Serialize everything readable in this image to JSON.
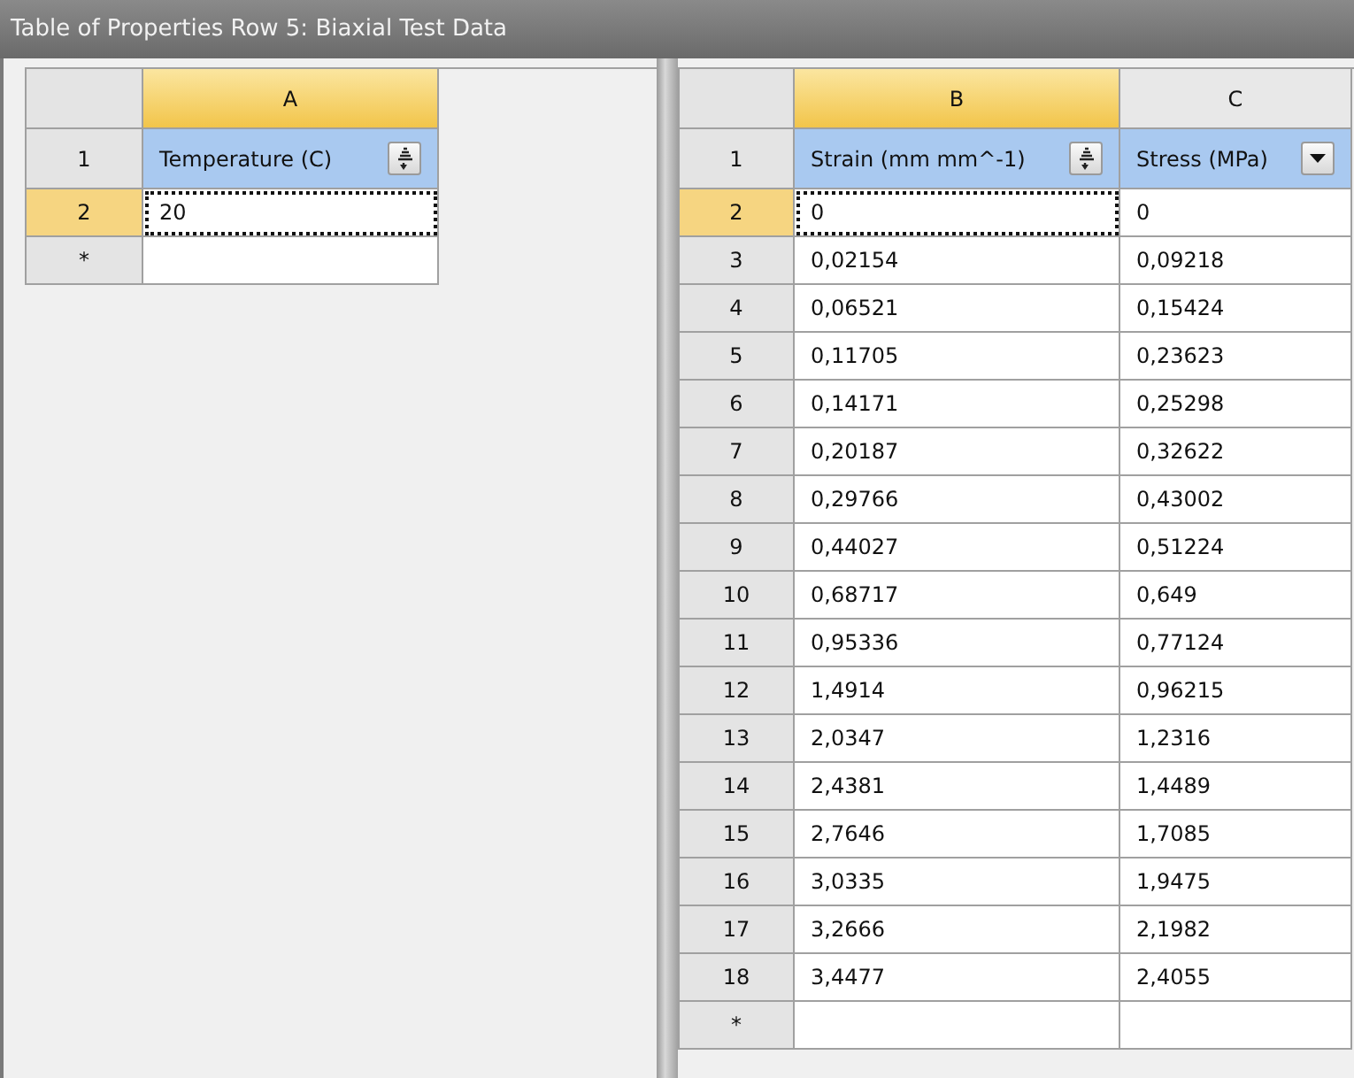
{
  "window": {
    "title": "Table of Properties Row 5: Biaxial Test Data"
  },
  "left_table": {
    "columns": [
      {
        "label": "A",
        "selected": true
      }
    ],
    "header_row": {
      "number": "1",
      "cells": [
        {
          "label": "Temperature (C)",
          "kind": "sort"
        }
      ]
    },
    "rows": [
      {
        "number": "2",
        "selected": true,
        "cells": [
          "20"
        ]
      }
    ],
    "new_row_marker": "*"
  },
  "right_table": {
    "columns": [
      {
        "label": "B",
        "selected": true
      },
      {
        "label": "C",
        "selected": false
      }
    ],
    "header_row": {
      "number": "1",
      "cells": [
        {
          "label": "Strain (mm mm^-1)",
          "kind": "sort"
        },
        {
          "label": "Stress (MPa)",
          "kind": "dropdown"
        }
      ]
    },
    "rows": [
      {
        "number": "2",
        "selected": true,
        "cells": [
          "0",
          "0"
        ]
      },
      {
        "number": "3",
        "selected": false,
        "cells": [
          "0,02154",
          "0,09218"
        ]
      },
      {
        "number": "4",
        "selected": false,
        "cells": [
          "0,06521",
          "0,15424"
        ]
      },
      {
        "number": "5",
        "selected": false,
        "cells": [
          "0,11705",
          "0,23623"
        ]
      },
      {
        "number": "6",
        "selected": false,
        "cells": [
          "0,14171",
          "0,25298"
        ]
      },
      {
        "number": "7",
        "selected": false,
        "cells": [
          "0,20187",
          "0,32622"
        ]
      },
      {
        "number": "8",
        "selected": false,
        "cells": [
          "0,29766",
          "0,43002"
        ]
      },
      {
        "number": "9",
        "selected": false,
        "cells": [
          "0,44027",
          "0,51224"
        ]
      },
      {
        "number": "10",
        "selected": false,
        "cells": [
          "0,68717",
          "0,649"
        ]
      },
      {
        "number": "11",
        "selected": false,
        "cells": [
          "0,95336",
          "0,77124"
        ]
      },
      {
        "number": "12",
        "selected": false,
        "cells": [
          "1,4914",
          "0,96215"
        ]
      },
      {
        "number": "13",
        "selected": false,
        "cells": [
          "2,0347",
          "1,2316"
        ]
      },
      {
        "number": "14",
        "selected": false,
        "cells": [
          "2,4381",
          "1,4489"
        ]
      },
      {
        "number": "15",
        "selected": false,
        "cells": [
          "2,7646",
          "1,7085"
        ]
      },
      {
        "number": "16",
        "selected": false,
        "cells": [
          "3,0335",
          "1,9475"
        ]
      },
      {
        "number": "17",
        "selected": false,
        "cells": [
          "3,2666",
          "2,1982"
        ]
      },
      {
        "number": "18",
        "selected": false,
        "cells": [
          "3,4477",
          "2,4055"
        ]
      }
    ],
    "new_row_marker": "*"
  }
}
